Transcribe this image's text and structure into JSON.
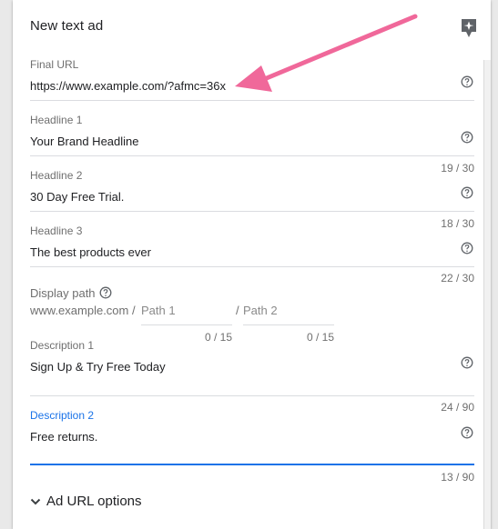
{
  "card": {
    "title": "New text ad"
  },
  "fields": {
    "final_url": {
      "label": "Final URL",
      "value": "https://www.example.com/?afmc=36x"
    },
    "headline1": {
      "label": "Headline 1",
      "value": "Your Brand Headline",
      "counter": "19 / 30"
    },
    "headline2": {
      "label": "Headline 2",
      "value": "30 Day Free Trial.",
      "counter": "18 / 30"
    },
    "headline3": {
      "label": "Headline 3",
      "value": "The best products ever",
      "counter": "22 / 30"
    },
    "display_path": {
      "label": "Display path",
      "domain": "www.example.com /",
      "path1_placeholder": "Path 1",
      "path1_counter": "0 / 15",
      "separator": "/",
      "path2_placeholder": "Path 2",
      "path2_counter": "0 / 15"
    },
    "description1": {
      "label": "Description 1",
      "value": "Sign Up & Try Free Today",
      "counter": "24 / 90"
    },
    "description2": {
      "label": "Description 2",
      "value": "Free returns.",
      "counter": "13 / 90"
    }
  },
  "ad_url_options": {
    "label": "Ad URL options"
  },
  "icons": {
    "pin": "pin-icon",
    "help": "help-circle-icon",
    "chevron": "chevron-down-icon"
  },
  "colors": {
    "accent_blue": "#1a73e8",
    "annotation_arrow": "#f0689a",
    "label_gray": "#6f6f6f",
    "text_dark": "#202124"
  }
}
